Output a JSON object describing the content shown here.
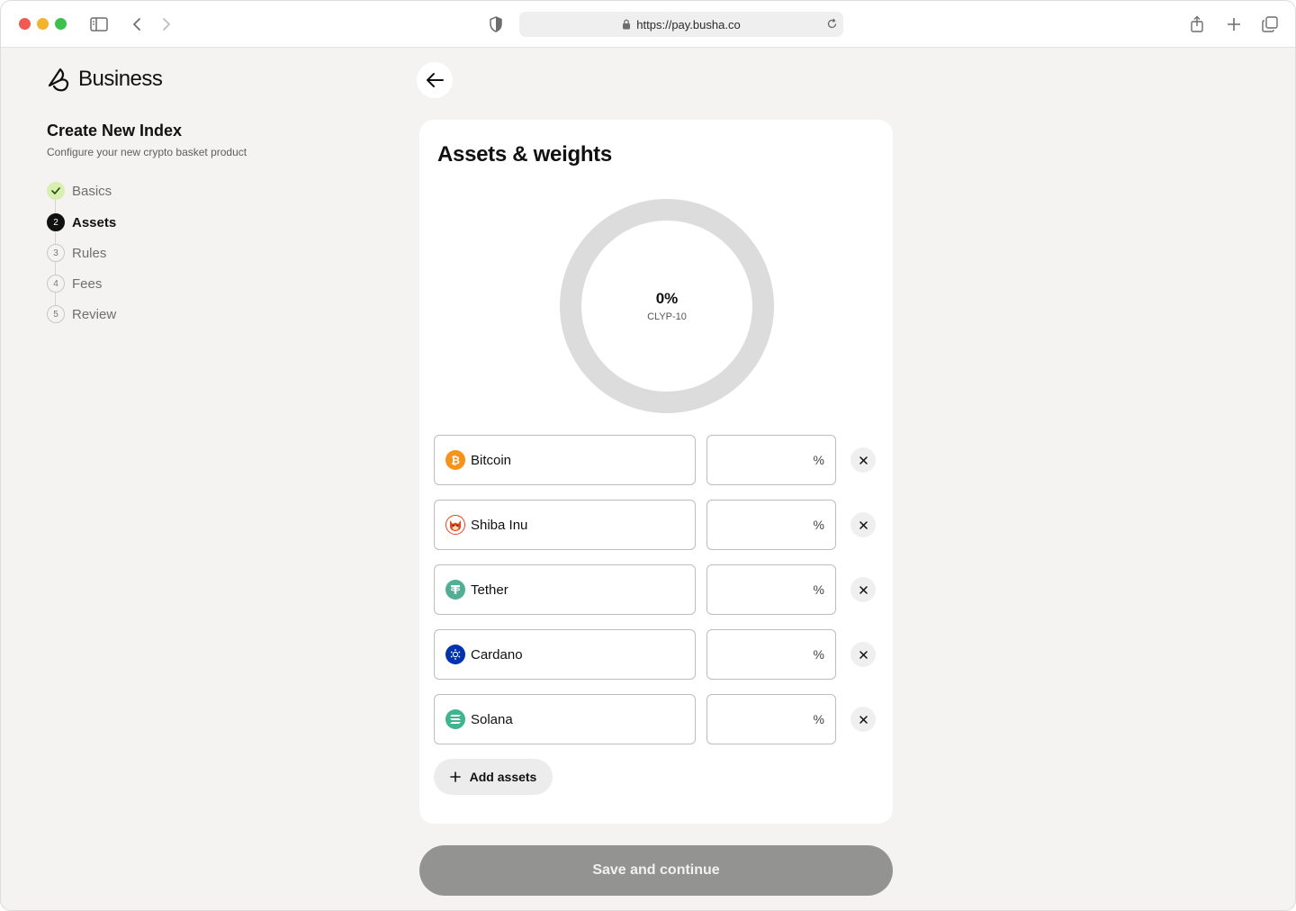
{
  "browser": {
    "url": "https://pay.busha.co"
  },
  "sidebar": {
    "logo_text": "Business",
    "title": "Create New Index",
    "subtitle": "Configure your new crypto basket product",
    "steps": [
      {
        "number": "",
        "label": "Basics",
        "state": "done"
      },
      {
        "number": "2",
        "label": "Assets",
        "state": "active"
      },
      {
        "number": "3",
        "label": "Rules",
        "state": "pending"
      },
      {
        "number": "4",
        "label": "Fees",
        "state": "pending"
      },
      {
        "number": "5",
        "label": "Review",
        "state": "pending"
      }
    ]
  },
  "card": {
    "title": "Assets & weights",
    "donut": {
      "percent_label": "0%",
      "ticker": "CLYP-10",
      "allocated_percent": 0,
      "track_color": "#dcdcdc"
    },
    "assets": [
      {
        "name": "Bitcoin",
        "icon": "bitcoin-icon",
        "color": "#f7931a",
        "weight": "",
        "unit": "%"
      },
      {
        "name": "Shiba Inu",
        "icon": "shiba-inu-icon",
        "color": "#e4441c",
        "weight": "",
        "unit": "%"
      },
      {
        "name": "Tether",
        "icon": "tether-icon",
        "color": "#50af95",
        "weight": "",
        "unit": "%"
      },
      {
        "name": "Cardano",
        "icon": "cardano-icon",
        "color": "#0033ad",
        "weight": "",
        "unit": "%"
      },
      {
        "name": "Solana",
        "icon": "solana-icon",
        "color": "#3fb58f",
        "weight": "",
        "unit": "%"
      }
    ],
    "add_label": "Add assets"
  },
  "footer": {
    "save_label": "Save and continue"
  }
}
